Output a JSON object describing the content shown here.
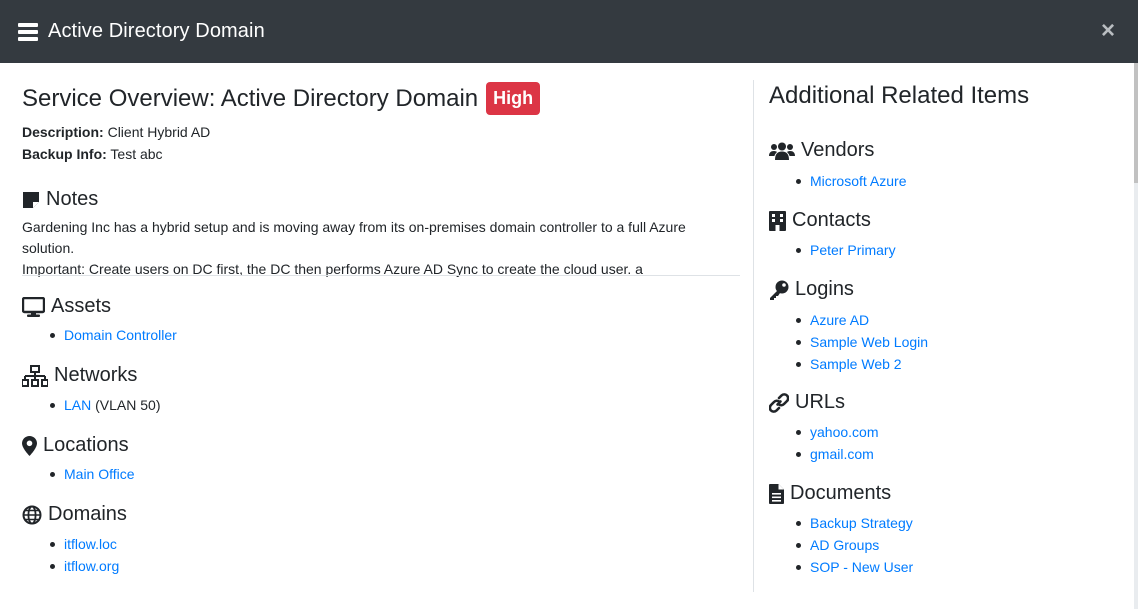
{
  "modal": {
    "title": "Active Directory Domain",
    "close_label": "×"
  },
  "overview": {
    "title": "Service Overview: Active Directory Domain",
    "importance": "High",
    "description_label": "Description:",
    "description": "Client Hybrid AD",
    "backup_label": "Backup Info:",
    "backup": "Test abc"
  },
  "notes": {
    "heading": "Notes",
    "line1": "Gardening Inc has a hybrid setup and is moving away from its on-premises domain controller to a full Azure solution.",
    "line2": "Important: Create users on DC first, the DC then performs Azure AD Sync to create the cloud user. a"
  },
  "assets": {
    "heading": "Assets",
    "items": [
      "Domain Controller"
    ]
  },
  "networks": {
    "heading": "Networks",
    "items": [
      {
        "label": "LAN",
        "suffix": " (VLAN 50)"
      }
    ]
  },
  "locations": {
    "heading": "Locations",
    "items": [
      "Main Office"
    ]
  },
  "domains": {
    "heading": "Domains",
    "items": [
      "itflow.loc",
      "itflow.org"
    ]
  },
  "related": {
    "title": "Additional Related Items",
    "vendors": {
      "heading": "Vendors",
      "items": [
        "Microsoft Azure"
      ]
    },
    "contacts": {
      "heading": "Contacts",
      "items": [
        "Peter Primary"
      ]
    },
    "logins": {
      "heading": "Logins",
      "items": [
        "Azure AD",
        "Sample Web Login",
        "Sample Web 2"
      ]
    },
    "urls": {
      "heading": "URLs",
      "items": [
        "yahoo.com",
        "gmail.com"
      ]
    },
    "documents": {
      "heading": "Documents",
      "items": [
        "Backup Strategy",
        "AD Groups",
        "SOP - New User"
      ]
    }
  },
  "colors": {
    "header_bg": "#343a40",
    "badge_high": "#dc3545",
    "link": "#007bff"
  }
}
